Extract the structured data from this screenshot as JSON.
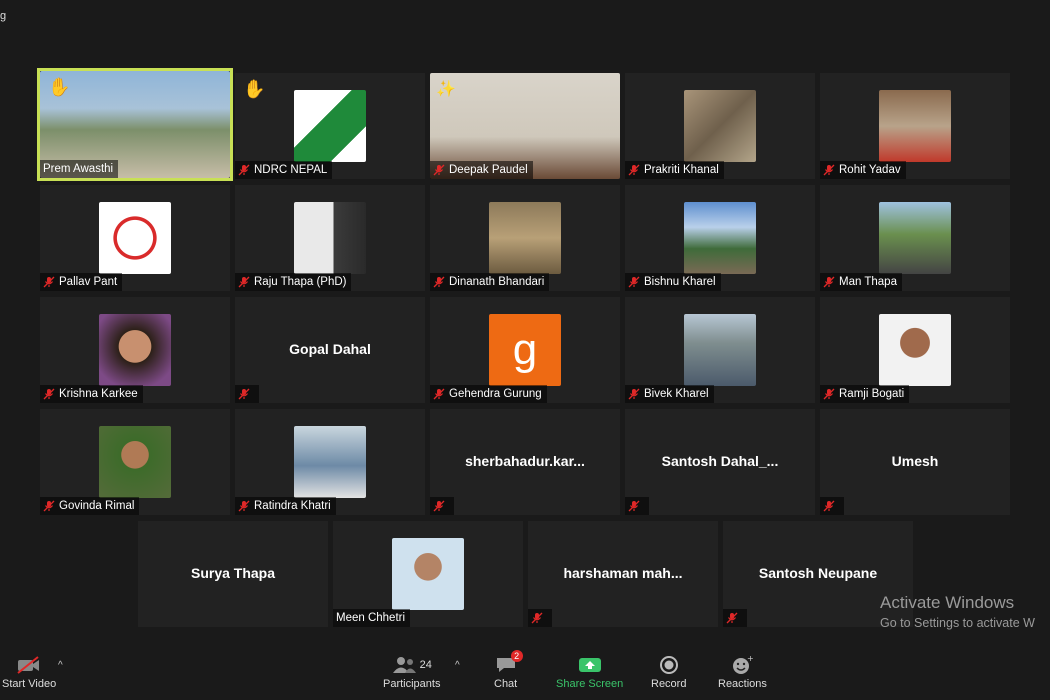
{
  "window": {
    "title_fragment": "g"
  },
  "participants": [
    {
      "name": "Prem Awasthi",
      "active": true,
      "hand": true,
      "photo": "landscape"
    },
    {
      "name": "NDRC NEPAL",
      "hand": true,
      "muted": true,
      "photo": "ndrc-logo"
    },
    {
      "name": "Deepak Paudel",
      "muted": true,
      "reaction": "confetti",
      "photo": "office"
    },
    {
      "name": "Prakriti Khanal",
      "muted": true,
      "photo": "rocks"
    },
    {
      "name": "Rohit Yadav",
      "muted": true,
      "photo": "helmet"
    },
    {
      "name": "Pallav Pant",
      "muted": true,
      "photo": "af-logo"
    },
    {
      "name": "Raju Thapa (PhD)",
      "muted": true,
      "photo": "awards"
    },
    {
      "name": "Dinanath Bhandari",
      "muted": true,
      "photo": "birds"
    },
    {
      "name": "Bishnu Kharel",
      "muted": true,
      "photo": "mountain"
    },
    {
      "name": "Man Thapa",
      "muted": true,
      "photo": "outdoor"
    },
    {
      "name": "Krishna Karkee",
      "muted": true,
      "photo": "portrait-f"
    },
    {
      "name": "",
      "big_name": "Gopal Dahal",
      "muted": true
    },
    {
      "name": "Gehendra Gurung",
      "muted": true,
      "photo": "g-letter",
      "photo_letter": "g"
    },
    {
      "name": "Bivek Kharel",
      "muted": true,
      "photo": "street"
    },
    {
      "name": "Ramji Bogati",
      "muted": true,
      "photo": "portrait-m"
    },
    {
      "name": "Govinda Rimal",
      "muted": true,
      "photo": "garden"
    },
    {
      "name": "Ratindra Khatri",
      "muted": true,
      "photo": "mask"
    },
    {
      "name": "",
      "big_name": "sherbahadur.kar...",
      "muted": true
    },
    {
      "name": "",
      "big_name": "Santosh  Dahal_...",
      "muted": true
    },
    {
      "name": "",
      "big_name": "Umesh",
      "muted": true
    },
    {
      "name": "",
      "big_name": "Surya Thapa",
      "muted": false
    },
    {
      "name": "Meen Chhetri",
      "muted": false,
      "photo": "passport"
    },
    {
      "name": "",
      "big_name": "harshaman  mah...",
      "muted": true
    },
    {
      "name": "",
      "big_name": "Santosh Neupane",
      "muted": true
    }
  ],
  "toolbar": {
    "start_video": "Start Video",
    "participants": "Participants",
    "participants_count": "24",
    "chat": "Chat",
    "chat_badge": "2",
    "share_screen": "Share Screen",
    "record": "Record",
    "reactions": "Reactions"
  },
  "watermark": {
    "line1": "Activate Windows",
    "line2": "Go to Settings to activate W"
  },
  "colors": {
    "active_border": "#c8e055",
    "share_green": "#3ac46a",
    "muted_red": "#e02828"
  }
}
